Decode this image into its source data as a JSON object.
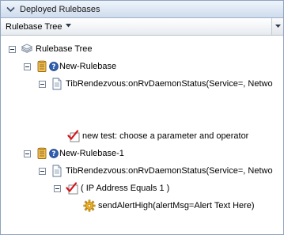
{
  "panel": {
    "title": "Deployed Rulebases",
    "column_header": "Rulebase Tree"
  },
  "tree": {
    "root": {
      "label": "Rulebase Tree",
      "icon": "layers-icon"
    },
    "rulebase1": {
      "label": "New-Rulebase",
      "icon": "rulebase-icon"
    },
    "rule1": {
      "label": "TibRendezvous:onRvDaemonStatus(Service=, Netwo",
      "icon": "document-icon"
    },
    "condition1": {
      "label": "new test: choose a parameter and operator",
      "icon": "checkmark-condition-icon"
    },
    "rulebase2": {
      "label": "New-Rulebase-1",
      "icon": "rulebase-icon"
    },
    "rule2": {
      "label": "TibRendezvous:onRvDaemonStatus(Service=, Netwo",
      "icon": "document-icon"
    },
    "condition2": {
      "label": "( IP Address Equals 1 )",
      "icon": "checkmark-condition-icon"
    },
    "action1": {
      "label": "sendAlertHigh(alertMsg=Alert Text Here)",
      "icon": "gear-action-icon"
    }
  }
}
